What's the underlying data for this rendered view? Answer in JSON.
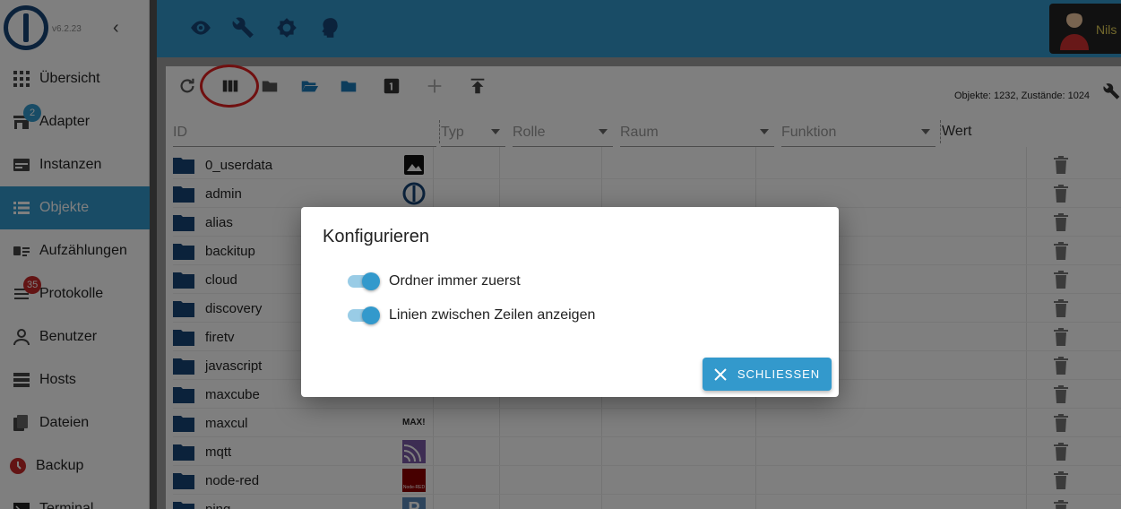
{
  "app": {
    "version": "v6.2.23",
    "user_name": "Nils"
  },
  "sidebar": {
    "items": [
      {
        "label": "Übersicht",
        "icon": "grid-icon"
      },
      {
        "label": "Adapter",
        "icon": "store-icon",
        "badge": "2"
      },
      {
        "label": "Instanzen",
        "icon": "instances-icon"
      },
      {
        "label": "Objekte",
        "icon": "list-icon",
        "active": true
      },
      {
        "label": "Aufzählungen",
        "icon": "enum-icon"
      },
      {
        "label": "Protokolle",
        "icon": "log-icon",
        "badge": "35"
      },
      {
        "label": "Benutzer",
        "icon": "person-icon"
      },
      {
        "label": "Hosts",
        "icon": "server-icon"
      },
      {
        "label": "Dateien",
        "icon": "files-icon"
      },
      {
        "label": "Backup",
        "icon": "backup-icon"
      },
      {
        "label": "Terminal",
        "icon": "terminal-icon"
      }
    ]
  },
  "topbar": {
    "icons": [
      "eye-icon",
      "wrench-icon",
      "theme-icon",
      "expert-mode-icon"
    ]
  },
  "toolbar": {
    "counts": "Objekte: 1232, Zustände: 1024"
  },
  "table": {
    "columns": {
      "id": "ID",
      "typ": "Typ",
      "rolle": "Rolle",
      "raum": "Raum",
      "funktion": "Funktion",
      "wert": "Wert"
    },
    "rows": [
      {
        "name": "0_userdata"
      },
      {
        "name": "admin"
      },
      {
        "name": "alias"
      },
      {
        "name": "backitup"
      },
      {
        "name": "cloud"
      },
      {
        "name": "discovery"
      },
      {
        "name": "firetv"
      },
      {
        "name": "javascript"
      },
      {
        "name": "maxcube"
      },
      {
        "name": "maxcul",
        "icon_text": "MAX!"
      },
      {
        "name": "mqtt"
      },
      {
        "name": "node-red",
        "icon_text": "Node-RED"
      },
      {
        "name": "ping",
        "icon_text": "P"
      }
    ]
  },
  "dialog": {
    "title": "Konfigurieren",
    "options": [
      {
        "label": "Ordner immer zuerst",
        "checked": true
      },
      {
        "label": "Linien zwischen Zeilen anzeigen",
        "checked": true
      }
    ],
    "close_label": "SCHLIESSEN"
  },
  "colors": {
    "primary": "#3399cc",
    "folder": "#164477",
    "annotation": "#e02020"
  }
}
